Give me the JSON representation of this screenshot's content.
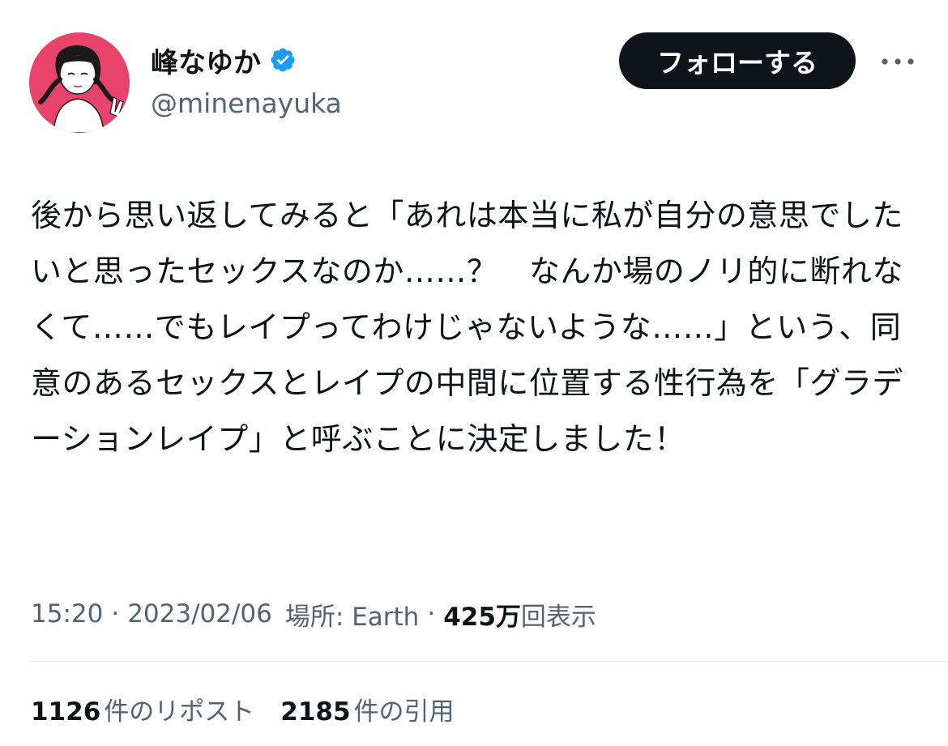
{
  "author": {
    "display_name": "峰なゆか",
    "handle": "@minenayuka",
    "verified": true,
    "avatar_icon": "avatar-illustration",
    "verified_icon": "verified-badge-icon"
  },
  "actions": {
    "follow_label": "フォローする",
    "more_icon": "more-dots-icon"
  },
  "tweet": {
    "text": "後から思い返してみると「あれは本当に私が自分の意思でしたいと思ったセックスなのか……？　なんか場のノリ的に断れなくて……でもレイプってわけじゃないような……」という、同意のあるセックスとレイプの中間に位置する性行為を「グラデーションレイプ」と呼ぶことに決定しました！"
  },
  "meta": {
    "time": "15:20",
    "separator": "·",
    "date": "2023/02/06",
    "location_label": "場所: Earth",
    "views_count": "425万",
    "views_label": "回表示"
  },
  "stats": {
    "reposts_count": "1126",
    "reposts_label": "件のリポスト",
    "quotes_count": "2185",
    "quotes_label": "件の引用"
  },
  "colors": {
    "text_primary": "#0f1419",
    "text_secondary": "#536471",
    "follow_bg": "#0f1419",
    "verified": "#1d9bf0",
    "avatar_bg": "#e8436a",
    "divider": "#e1e6ea"
  }
}
